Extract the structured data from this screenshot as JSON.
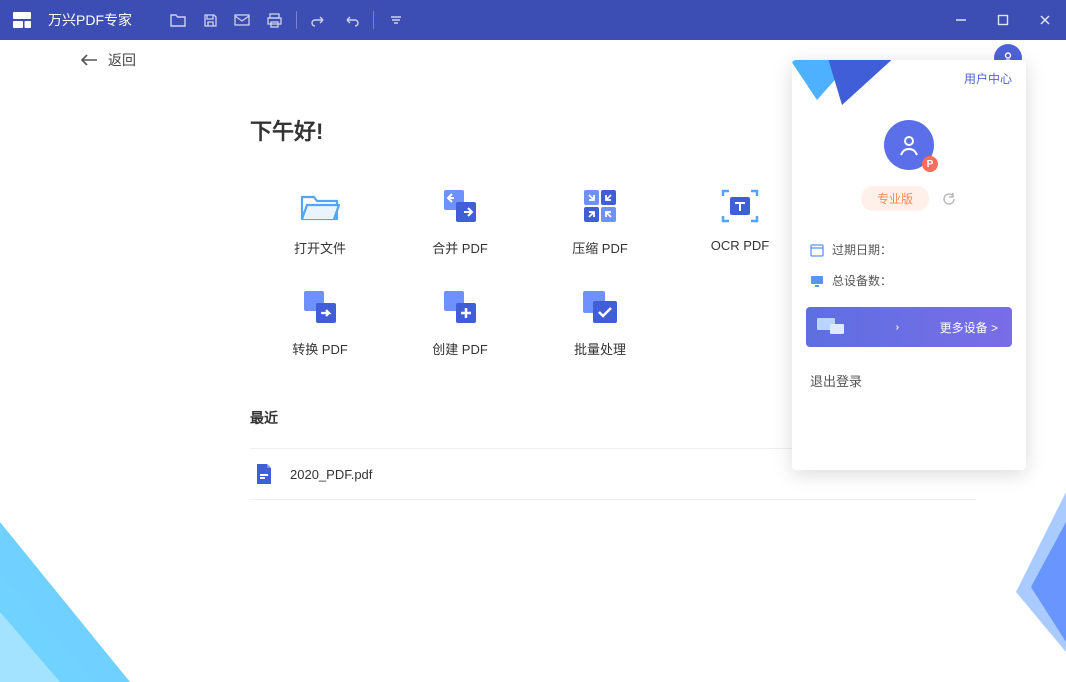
{
  "app": {
    "title": "万兴PDF专家"
  },
  "back": {
    "label": "返回"
  },
  "greeting": "下午好!",
  "actions": [
    {
      "id": "open-file",
      "label": "打开文件"
    },
    {
      "id": "merge-pdf",
      "label": "合并 PDF"
    },
    {
      "id": "compress-pdf",
      "label": "压缩 PDF"
    },
    {
      "id": "ocr-pdf",
      "label": "OCR PDF"
    },
    {
      "id": "convert-pdf",
      "label": "转换 PDF"
    },
    {
      "id": "create-pdf",
      "label": "创建 PDF"
    },
    {
      "id": "batch-process",
      "label": "批量处理"
    }
  ],
  "recent": {
    "title": "最近",
    "items": [
      {
        "name": "2020_PDF.pdf"
      }
    ]
  },
  "user_panel": {
    "user_center": "用户中心",
    "tier": "专业版",
    "expire_label": "过期日期：",
    "devices_label": "总设备数：",
    "more_devices": "更多设备 >",
    "logout": "退出登录",
    "badge": "P"
  }
}
